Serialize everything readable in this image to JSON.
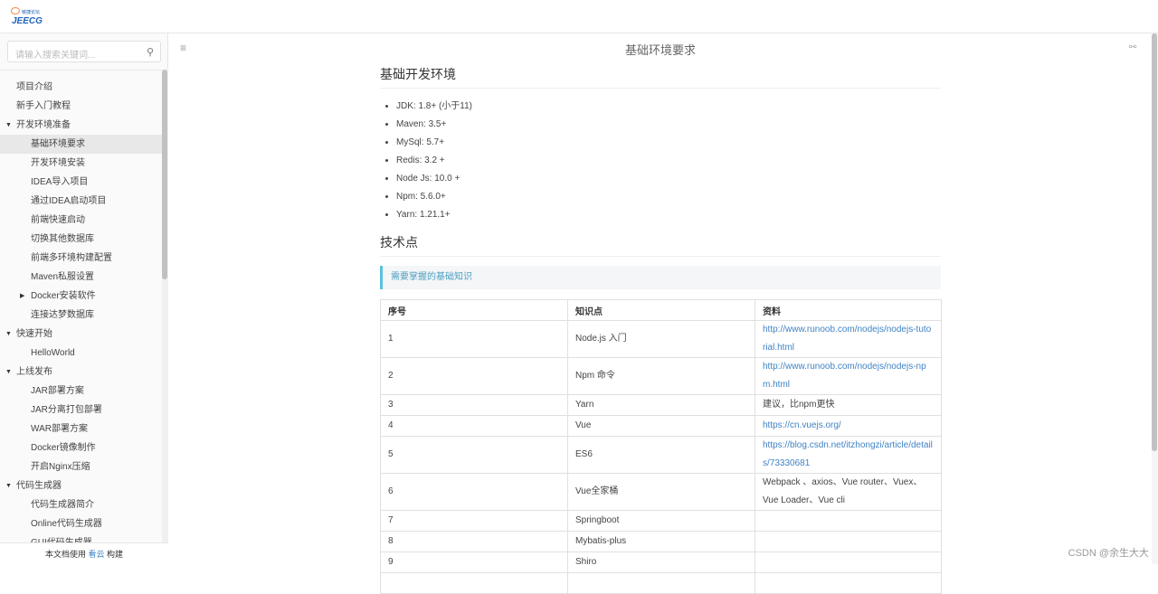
{
  "logo": {
    "small": "敏捷论坛",
    "big": "JEECG"
  },
  "search": {
    "placeholder": "请输入搜索关键词..."
  },
  "nav": [
    {
      "label": "项目介绍",
      "level": 0
    },
    {
      "label": "新手入门教程",
      "level": 0
    },
    {
      "label": "开发环境准备",
      "level": 0,
      "caret": "▼"
    },
    {
      "label": "基础环境要求",
      "level": 1,
      "active": true
    },
    {
      "label": "开发环境安装",
      "level": 1
    },
    {
      "label": "IDEA导入项目",
      "level": 1
    },
    {
      "label": "通过IDEA启动项目",
      "level": 1
    },
    {
      "label": "前端快速启动",
      "level": 1
    },
    {
      "label": "切换其他数据库",
      "level": 1
    },
    {
      "label": "前端多环境构建配置",
      "level": 1
    },
    {
      "label": "Maven私服设置",
      "level": 1
    },
    {
      "label": "Docker安装软件",
      "level": 1,
      "caret": "▶"
    },
    {
      "label": "连接达梦数据库",
      "level": 1
    },
    {
      "label": "快速开始",
      "level": 0,
      "caret": "▼"
    },
    {
      "label": "HelloWorld",
      "level": 1
    },
    {
      "label": "上线发布",
      "level": 0,
      "caret": "▼"
    },
    {
      "label": "JAR部署方案",
      "level": 1
    },
    {
      "label": "JAR分离打包部署",
      "level": 1
    },
    {
      "label": "WAR部署方案",
      "level": 1
    },
    {
      "label": "Docker镜像制作",
      "level": 1
    },
    {
      "label": "开启Nginx压缩",
      "level": 1
    },
    {
      "label": "代码生成器",
      "level": 0,
      "caret": "▼"
    },
    {
      "label": "代码生成器简介",
      "level": 1
    },
    {
      "label": "Online代码生成器",
      "level": 1
    },
    {
      "label": "GUI代码生成器",
      "level": 1
    }
  ],
  "footer": {
    "pre": "本文档使用 ",
    "link": "看云",
    "post": " 构建"
  },
  "header": {
    "title": "基础环境要求"
  },
  "section1": {
    "title": "基础开发环境",
    "items": [
      "JDK: 1.8+ (小于11)",
      "Maven: 3.5+",
      "MySql: 5.7+",
      "Redis: 3.2 +",
      "Node Js: 10.0 +",
      "Npm: 5.6.0+",
      "Yarn: 1.21.1+"
    ]
  },
  "section2": {
    "title": "技术点",
    "tip": "需要掌握的基础知识"
  },
  "table": {
    "headers": [
      "序号",
      "知识点",
      "资料"
    ],
    "rows": [
      {
        "n": "1",
        "topic": "Node.js 入门",
        "ref": "http://www.runoob.com/nodejs/nodejs-tutorial.html",
        "link": true
      },
      {
        "n": "2",
        "topic": "Npm 命令",
        "ref": "http://www.runoob.com/nodejs/nodejs-npm.html",
        "link": true
      },
      {
        "n": "3",
        "topic": "Yarn",
        "ref": "建议，比npm更快",
        "link": false
      },
      {
        "n": "4",
        "topic": "Vue",
        "ref": "https://cn.vuejs.org/",
        "link": true
      },
      {
        "n": "5",
        "topic": "ES6",
        "ref": "https://blog.csdn.net/itzhongzi/article/details/73330681",
        "link": true
      },
      {
        "n": "6",
        "topic": "Vue全家桶",
        "ref": "Webpack 、axios、Vue router、Vuex、Vue Loader、Vue cli",
        "link": false
      },
      {
        "n": "7",
        "topic": "Springboot",
        "ref": "",
        "link": false
      },
      {
        "n": "8",
        "topic": "Mybatis-plus",
        "ref": "",
        "link": false
      },
      {
        "n": "9",
        "topic": "Shiro",
        "ref": "",
        "link": false
      },
      {
        "n": "",
        "topic": "",
        "ref": "",
        "link": false
      }
    ]
  },
  "watermark": "CSDN @余生大大"
}
